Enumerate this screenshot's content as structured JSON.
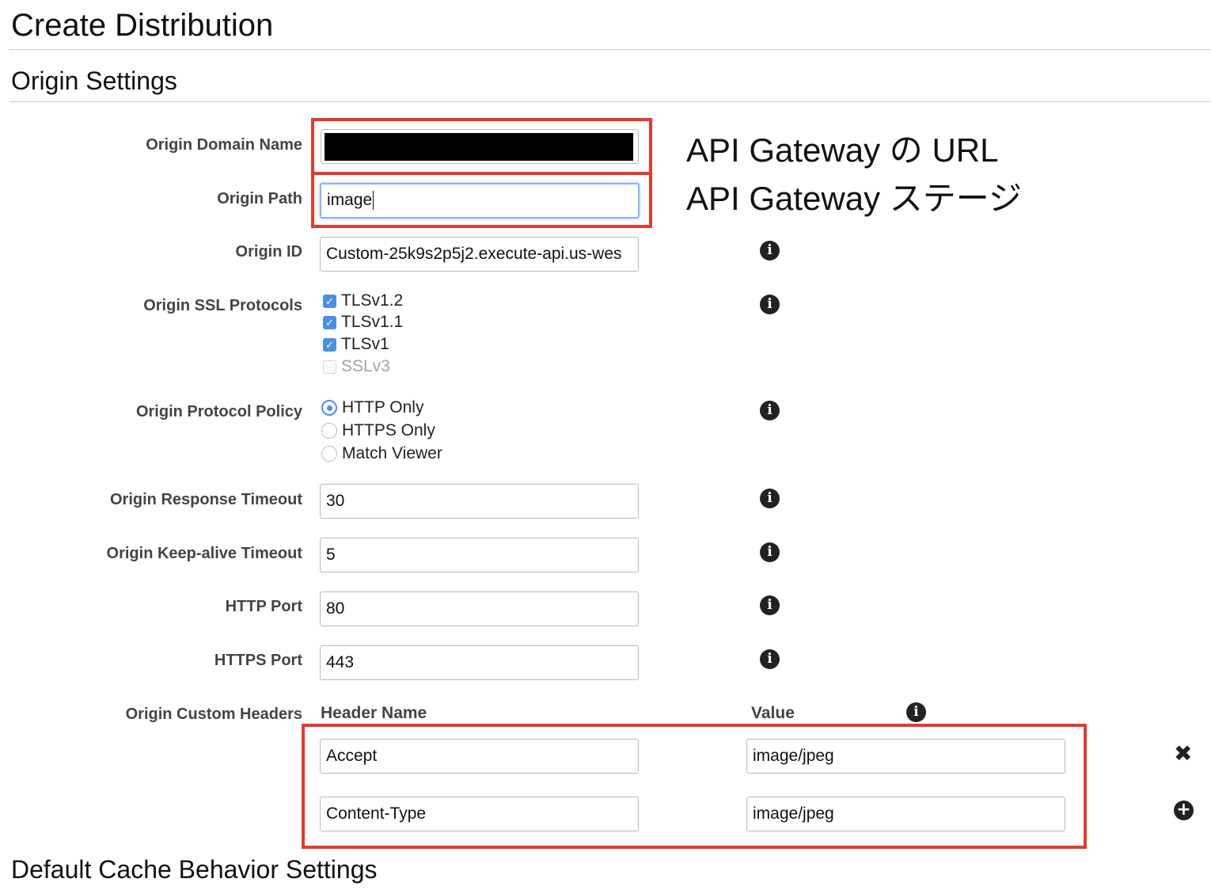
{
  "page": {
    "title": "Create Distribution",
    "section_title": "Origin Settings",
    "next_section_title": "Default Cache Behavior Settings"
  },
  "annotations": {
    "domain_note": "API Gateway の URL",
    "path_note": "API Gateway ステージ"
  },
  "fields": {
    "origin_domain_name": {
      "label": "Origin Domain Name",
      "value": ""
    },
    "origin_path": {
      "label": "Origin Path",
      "value": "image"
    },
    "origin_id": {
      "label": "Origin ID",
      "value": "Custom-25k9s2p5j2.execute-api.us-wes"
    },
    "ssl_protocols": {
      "label": "Origin SSL Protocols",
      "options": [
        {
          "label": "TLSv1.2",
          "checked": true
        },
        {
          "label": "TLSv1.1",
          "checked": true
        },
        {
          "label": "TLSv1",
          "checked": true
        },
        {
          "label": "SSLv3",
          "checked": false
        }
      ]
    },
    "protocol_policy": {
      "label": "Origin Protocol Policy",
      "options": [
        "HTTP Only",
        "HTTPS Only",
        "Match Viewer"
      ],
      "selected": "HTTP Only"
    },
    "response_timeout": {
      "label": "Origin Response Timeout",
      "value": "30"
    },
    "keepalive_timeout": {
      "label": "Origin Keep-alive Timeout",
      "value": "5"
    },
    "http_port": {
      "label": "HTTP Port",
      "value": "80"
    },
    "https_port": {
      "label": "HTTPS Port",
      "value": "443"
    },
    "custom_headers": {
      "label": "Origin Custom Headers",
      "header_name_col": "Header Name",
      "value_col": "Value",
      "rows": [
        {
          "name": "Accept",
          "value": "image/jpeg"
        },
        {
          "name": "Content-Type",
          "value": "image/jpeg"
        }
      ]
    }
  },
  "icons": {
    "info": "info-icon",
    "remove": "close-icon",
    "add": "plus-circle-icon",
    "info_glyph": "i",
    "remove_glyph": "✖",
    "add_glyph": "+"
  },
  "colors": {
    "highlight_border": "#e53a2e",
    "checkbox_blue": "#4a90e2"
  }
}
